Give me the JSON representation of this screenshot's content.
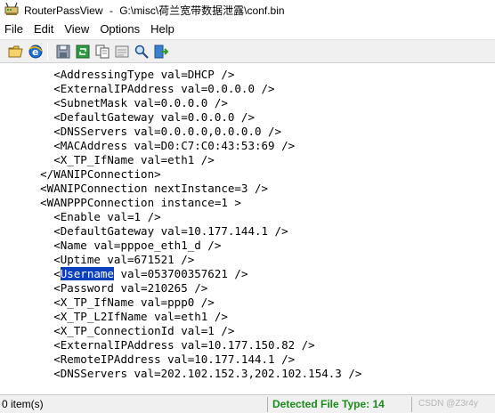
{
  "window": {
    "app_name": "RouterPassView",
    "file_path": "G:\\misc\\荷兰宽带数据泄露\\conf.bin",
    "title_separator": "-"
  },
  "menu": [
    "File",
    "Edit",
    "View",
    "Options",
    "Help"
  ],
  "toolbar": {
    "icons": [
      "open-folder-icon",
      "internet-explorer-icon",
      "save-icon",
      "refresh-icon",
      "copy-icon",
      "properties-icon",
      "find-icon",
      "exit-icon"
    ]
  },
  "editor": {
    "lines": [
      "        <AddressingType val=DHCP />",
      "        <ExternalIPAddress val=0.0.0.0 />",
      "        <SubnetMask val=0.0.0.0 />",
      "        <DefaultGateway val=0.0.0.0 />",
      "        <DNSServers val=0.0.0.0,0.0.0.0 />",
      "        <MACAddress val=D0:C7:C0:43:53:69 />",
      "        <X_TP_IfName val=eth1 />",
      "      </WANIPConnection>",
      "      <WANIPConnection nextInstance=3 />",
      "      <WANPPPConnection instance=1 >",
      "        <Enable val=1 />",
      "        <DefaultGateway val=10.177.144.1 />",
      "        <Name val=pppoe_eth1_d />",
      "        <Uptime val=671521 />",
      {
        "pre": "        <",
        "hl": "Username",
        "post": " val=053700357621 />"
      },
      "        <Password val=210265 />",
      "        <X_TP_IfName val=ppp0 />",
      "        <X_TP_L2IfName val=eth1 />",
      "        <X_TP_ConnectionId val=1 />",
      "        <ExternalIPAddress val=10.177.150.82 />",
      "        <RemoteIPAddress val=10.177.144.1 />",
      "        <DNSServers val=202.102.152.3,202.102.154.3 />"
    ],
    "selection_color": "#0a3fbf"
  },
  "status": {
    "items": "0 item(s)",
    "detected": "Detected File Type: 14",
    "detected_color": "#1a8c1a",
    "watermark": "CSDN @Z3r4y"
  }
}
